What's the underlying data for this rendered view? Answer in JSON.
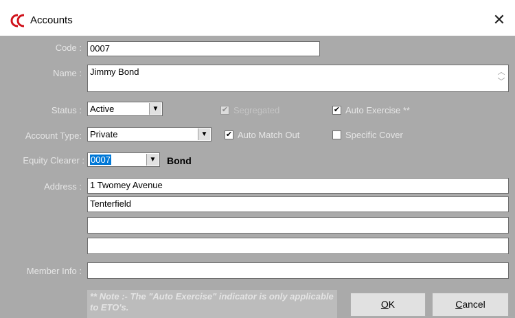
{
  "window": {
    "title": "Accounts",
    "close_glyph": "✕",
    "app_icon": "app-logo-icon"
  },
  "form": {
    "code": {
      "label": "Code :",
      "value": "0007"
    },
    "name": {
      "label": "Name :",
      "value": "Jimmy Bond"
    },
    "status": {
      "label": "Status :",
      "value": "Active"
    },
    "account_type": {
      "label": "Account Type:",
      "value": "Private"
    },
    "equity_clearer": {
      "label": "Equity Clearer :",
      "value": "0007",
      "name_display": "Bond"
    },
    "address": {
      "label": "Address :",
      "lines": [
        "1 Twomey Avenue",
        "Tenterfield",
        "",
        ""
      ]
    },
    "member_info": {
      "label": "Member Info :",
      "value": ""
    }
  },
  "checkboxes": {
    "segregated": {
      "label": "Segregated",
      "checked": true,
      "enabled": false
    },
    "auto_exercise": {
      "label": "Auto Exercise **",
      "checked": true,
      "enabled": true
    },
    "auto_match_out": {
      "label": "Auto Match Out",
      "checked": true,
      "enabled": true
    },
    "specific_cover": {
      "label": "Specific Cover",
      "checked": false,
      "enabled": true
    }
  },
  "note": "** Note :- The \"Auto Exercise\" indicator is only applicable to ETO's.",
  "buttons": {
    "ok": {
      "accel": "O",
      "rest": "K"
    },
    "cancel": {
      "accel": "C",
      "rest": "ancel"
    }
  },
  "colors": {
    "client_bg": "#aaaaaa",
    "selection": "#0078d7",
    "logo_red": "#d0121b"
  }
}
